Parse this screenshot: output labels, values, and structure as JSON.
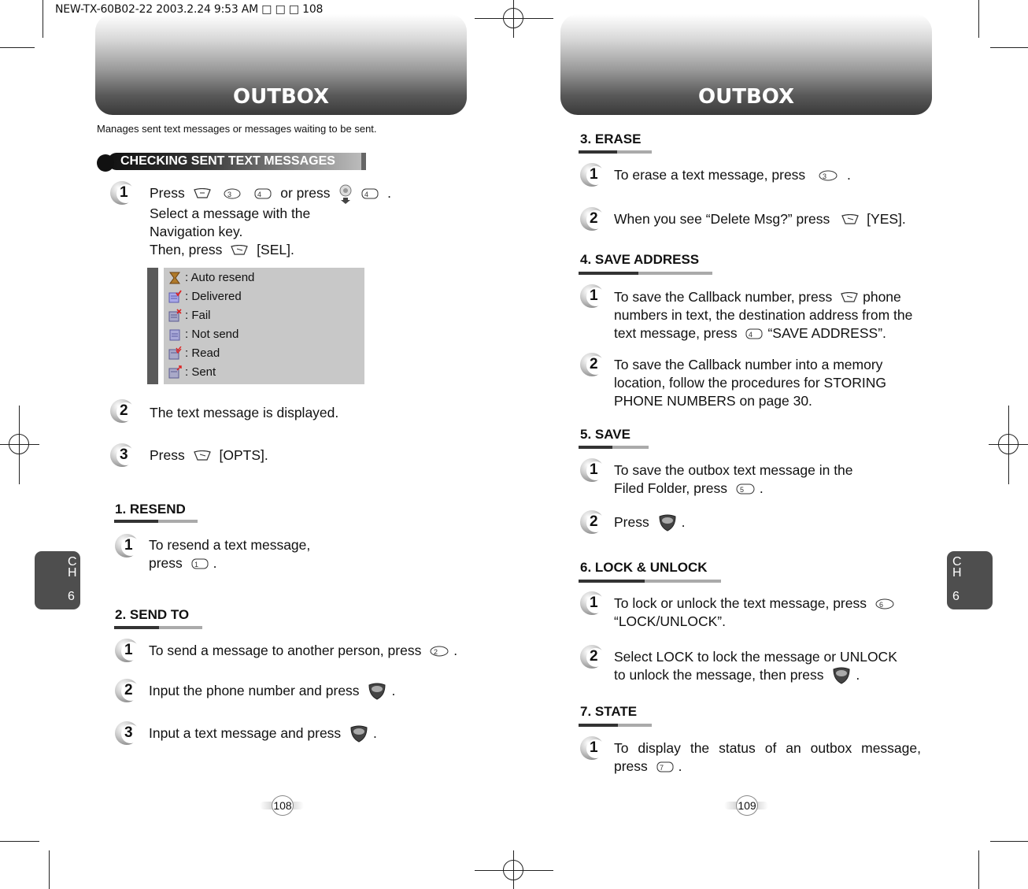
{
  "slug": "NEW-TX-60B02-22  2003.2.24 9:53 AM  □ □ □ 108",
  "left_page": {
    "banner_title": "OUTBOX",
    "intro": "Manages sent text messages or messages waiting to be sent.",
    "section_title": "CHECKING SENT TEXT MESSAGES",
    "steps": [
      {
        "num": "1",
        "lines": [
          "Press",
          "or press",
          ".",
          "Select a message with the",
          "Navigation key.",
          "Then, press",
          "[SEL]."
        ]
      },
      {
        "num": "2",
        "text": "The text message is displayed."
      },
      {
        "num": "3",
        "pre": "Press",
        "post": "[OPTS]."
      }
    ],
    "legend": [
      {
        "icon": "hourglass-icon",
        "label": ": Auto resend"
      },
      {
        "icon": "message-delivered-icon",
        "label": ": Delivered"
      },
      {
        "icon": "message-fail-icon",
        "label": ": Fail"
      },
      {
        "icon": "message-not-send-icon",
        "label": ": Not send"
      },
      {
        "icon": "message-read-icon",
        "label": ": Read"
      },
      {
        "icon": "message-sent-icon",
        "label": ": Sent"
      }
    ],
    "resend": {
      "title": "1. RESEND",
      "steps": [
        {
          "num": "1",
          "line1": "To resend a text message,",
          "line2_pre": "press",
          "line2_post": "."
        }
      ]
    },
    "send_to": {
      "title": "2. SEND TO",
      "steps": [
        {
          "num": "1",
          "pre": "To send a message to another person, press",
          "post": "."
        },
        {
          "num": "2",
          "pre": "Input the phone number and press",
          "post": "."
        },
        {
          "num": "3",
          "pre": "Input a text message and press",
          "post": "."
        }
      ]
    },
    "page_number": "108",
    "chapter_tab": {
      "c": "C",
      "h": "H",
      "n": "6"
    }
  },
  "right_page": {
    "banner_title": "OUTBOX",
    "erase": {
      "title": "3. ERASE",
      "steps": [
        {
          "num": "1",
          "pre": "To erase a text message, press",
          "post": "."
        },
        {
          "num": "2",
          "pre": "When you see “Delete Msg?” press",
          "post": "[YES]."
        }
      ]
    },
    "save_address": {
      "title": "4. SAVE ADDRESS",
      "steps": [
        {
          "num": "1",
          "l1_pre": "To save the Callback number, press",
          "l1_post": "phone",
          "l2": "numbers in text, the destination address from the",
          "l3_pre": "text message, press",
          "l3_post": "“SAVE ADDRESS”."
        },
        {
          "num": "2",
          "l1": "To save the Callback number into a memory",
          "l2": "location, follow the procedures for STORING",
          "l3": "PHONE NUMBERS on page 30."
        }
      ]
    },
    "save": {
      "title": "5. SAVE",
      "steps": [
        {
          "num": "1",
          "l1": "To save the outbox text message in the",
          "l2_pre": "Filed Folder, press",
          "l2_post": "."
        },
        {
          "num": "2",
          "pre": "Press",
          "post": "."
        }
      ]
    },
    "lock": {
      "title": "6. LOCK & UNLOCK",
      "steps": [
        {
          "num": "1",
          "l1_pre": "To lock or unlock the text message, press",
          "l2": "“LOCK/UNLOCK”."
        },
        {
          "num": "2",
          "l1": "Select LOCK to lock the message or UNLOCK",
          "l2_pre": "to unlock the message, then press",
          "l2_post": "."
        }
      ]
    },
    "state": {
      "title": "7. STATE",
      "steps": [
        {
          "num": "1",
          "l1": "To display the status of an outbox message,",
          "l2_pre": "press",
          "l2_post": "."
        }
      ]
    },
    "page_number": "109",
    "chapter_tab": {
      "c": "C",
      "h": "H",
      "n": "6"
    }
  }
}
